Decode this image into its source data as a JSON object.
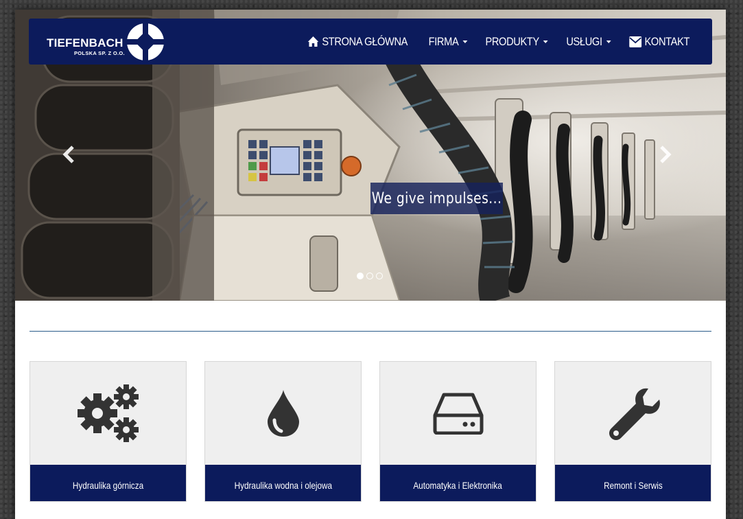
{
  "brand": {
    "name": "TIEFENBACH",
    "subtitle": "POLSKA SP. Z O.O.",
    "navy": "#0c1b5c"
  },
  "nav": {
    "items": [
      {
        "label": "STRONA GŁÓWNA",
        "icon": "home-icon",
        "dropdown": false
      },
      {
        "label": "FIRMA",
        "icon": null,
        "dropdown": true
      },
      {
        "label": "PRODUKTY",
        "icon": null,
        "dropdown": true
      },
      {
        "label": "USŁUGI",
        "icon": null,
        "dropdown": true
      },
      {
        "label": "KONTAKT",
        "icon": "envelope-icon",
        "dropdown": false
      }
    ]
  },
  "carousel": {
    "caption": "We give impulses...",
    "slide_count": 3,
    "active_slide": 1
  },
  "cards": [
    {
      "label": "Hydraulika górnicza",
      "icon": "gears-icon"
    },
    {
      "label": "Hydraulika wodna i olejowa",
      "icon": "drop-icon"
    },
    {
      "label": "Automatyka i Elektronika",
      "icon": "hard-drive-icon"
    },
    {
      "label": "Remont i Serwis",
      "icon": "wrench-icon"
    }
  ]
}
